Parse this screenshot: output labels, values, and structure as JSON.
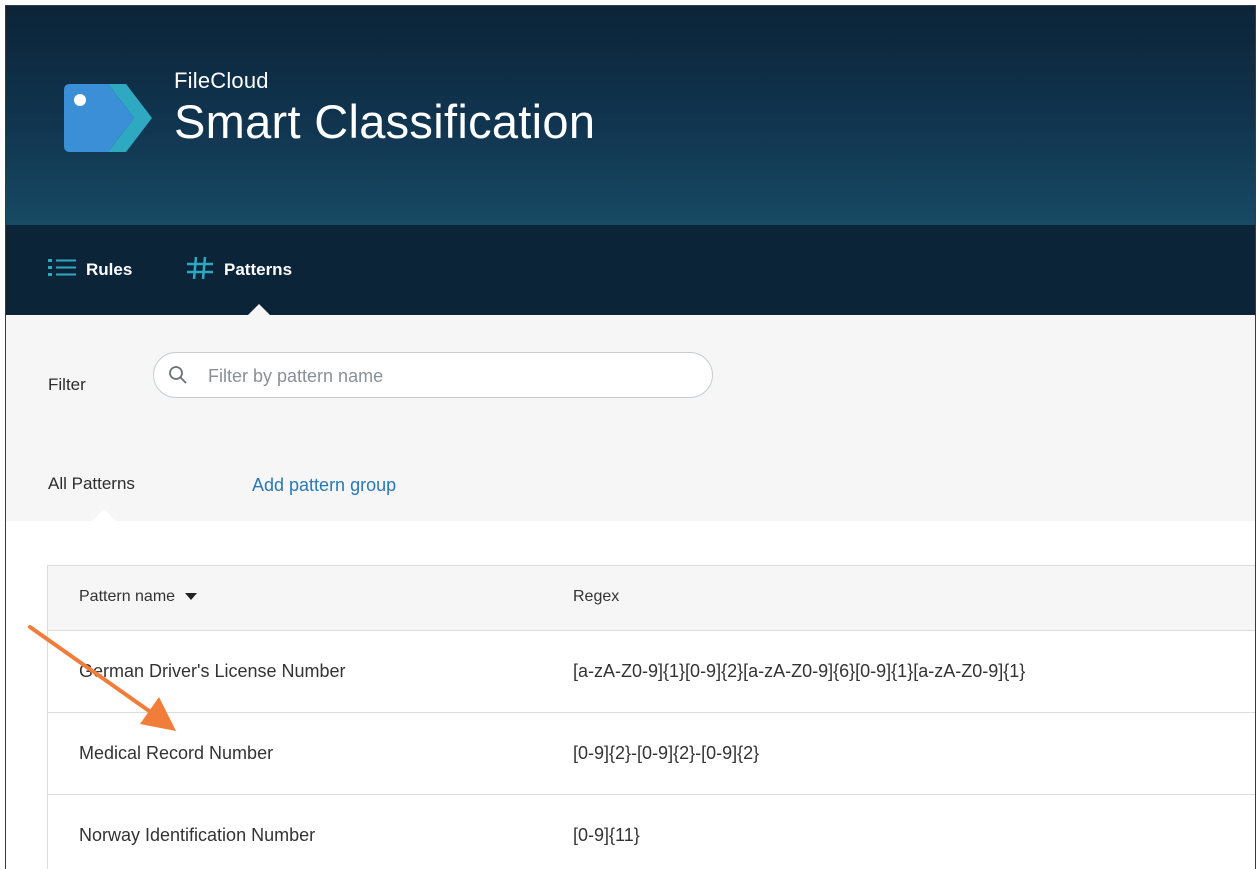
{
  "brand": {
    "company": "FileCloud",
    "product": "Smart Classification",
    "logo_icon": "tag-arrow-logo-icon"
  },
  "nav": {
    "items": [
      {
        "label": "Rules",
        "icon": "list-icon"
      },
      {
        "label": "Patterns",
        "icon": "hash-icon",
        "active": true
      }
    ]
  },
  "filter": {
    "label": "Filter",
    "placeholder": "Filter by pattern name",
    "value": ""
  },
  "tabs": {
    "all_patterns": "All Patterns",
    "add_group": "Add pattern group"
  },
  "table": {
    "columns": [
      "Pattern name",
      "Regex"
    ],
    "rows": [
      {
        "name": "German Driver's License Number",
        "regex": "[a-zA-Z0-9]{1}[0-9]{2}[a-zA-Z0-9]{6}[0-9]{1}[a-zA-Z0-9]{1}"
      },
      {
        "name": "Medical Record Number",
        "regex": "[0-9]{2}-[0-9]{2}-[0-9]{2}"
      },
      {
        "name": "Norway Identification Number",
        "regex": "[0-9]{11}"
      }
    ]
  },
  "colors": {
    "header_dark": "#0b2438",
    "accent_link": "#2a78b4",
    "annotation_arrow": "#f07d3a",
    "logo_teal": "#2fa9c2"
  }
}
